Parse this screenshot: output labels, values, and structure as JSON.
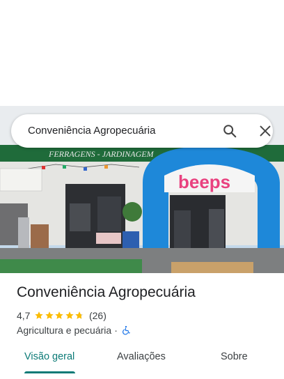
{
  "search": {
    "query": "Conveniência Agropecuária"
  },
  "hero": {
    "sign_text": "FERRAGENS - JARDINAGEM",
    "arch_logo": "beeps"
  },
  "place": {
    "title": "Conveniência Agropecuária",
    "rating": "4,7",
    "rating_value": 4.7,
    "review_count": "(26)",
    "category": "Agricultura e pecuária",
    "separator": "·"
  },
  "tabs": [
    {
      "label": "Visão geral",
      "active": true
    },
    {
      "label": "Avaliações",
      "active": false
    },
    {
      "label": "Sobre",
      "active": false
    }
  ],
  "colors": {
    "accent": "#0b7a76",
    "star": "#fbbc04",
    "accessibility": "#1a73e8"
  },
  "icons": {
    "search": "search-icon",
    "close": "close-icon",
    "accessible": "wheelchair-icon"
  }
}
